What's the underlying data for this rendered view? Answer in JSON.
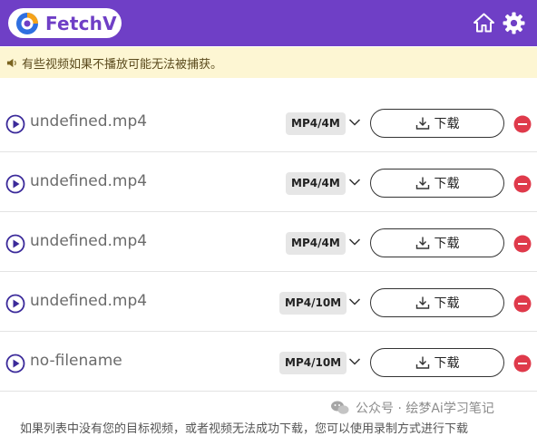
{
  "header": {
    "brand": "FetchV",
    "colors": {
      "bar": "#6f3fc6",
      "logo_blue": "#2f6fe0",
      "logo_orange": "#f5a31a"
    }
  },
  "notice": {
    "text": "有些视频如果不播放可能无法被捕获。"
  },
  "videos": [
    {
      "filename": "undefined.mp4",
      "format": "MP4/4M",
      "download_label": "下载"
    },
    {
      "filename": "undefined.mp4",
      "format": "MP4/4M",
      "download_label": "下载"
    },
    {
      "filename": "undefined.mp4",
      "format": "MP4/4M",
      "download_label": "下载"
    },
    {
      "filename": "undefined.mp4",
      "format": "MP4/10M",
      "download_label": "下载"
    },
    {
      "filename": "no-filename",
      "format": "MP4/10M",
      "download_label": "下载"
    }
  ],
  "footer": {
    "text": "如果列表中没有您的目标视频，或者视频无法成功下载，您可以使用录制方式进行下载"
  },
  "watermark": {
    "text": "公众号 · 绘梦Ai学习笔记"
  },
  "icons": {
    "logo": "fetchv-logo-icon",
    "home": "home-icon",
    "settings": "gear-icon",
    "notice": "speaker-icon",
    "play": "play-circle-icon",
    "expand": "chevron-down-icon",
    "download": "download-icon",
    "remove": "remove-circle-icon"
  }
}
